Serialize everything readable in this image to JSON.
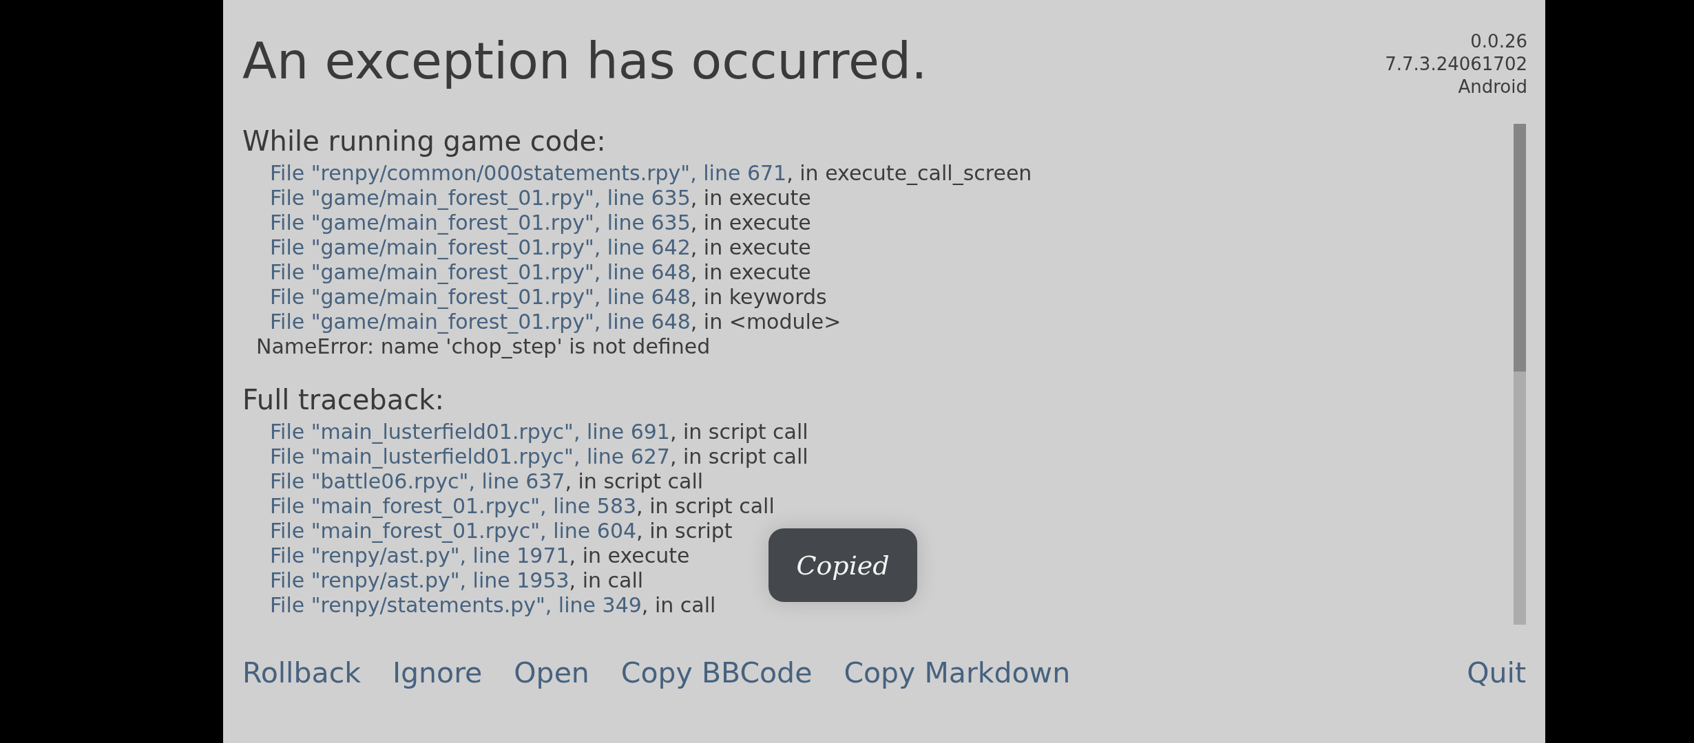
{
  "title": "An exception has occurred.",
  "version_info": [
    "0.0.26",
    "7.7.3.24061702",
    "Android"
  ],
  "sections": [
    {
      "heading": "While running game code:",
      "frames": [
        {
          "location": "File \"renpy/common/000statements.rpy\", line 671",
          "context": ", in execute_call_screen"
        },
        {
          "location": "File \"game/main_forest_01.rpy\", line 635",
          "context": ", in execute"
        },
        {
          "location": "File \"game/main_forest_01.rpy\", line 635",
          "context": ", in execute"
        },
        {
          "location": "File \"game/main_forest_01.rpy\", line 642",
          "context": ", in execute"
        },
        {
          "location": "File \"game/main_forest_01.rpy\", line 648",
          "context": ", in execute"
        },
        {
          "location": "File \"game/main_forest_01.rpy\", line 648",
          "context": ", in keywords"
        },
        {
          "location": "File \"game/main_forest_01.rpy\", line 648",
          "context": ", in <module>"
        }
      ],
      "error": "NameError: name 'chop_step' is not defined"
    },
    {
      "heading": "Full traceback:",
      "frames": [
        {
          "location": "File \"main_lusterfield01.rpyc\", line 691",
          "context": ", in script call"
        },
        {
          "location": "File \"main_lusterfield01.rpyc\", line 627",
          "context": ", in script call"
        },
        {
          "location": "File \"battle06.rpyc\", line 637",
          "context": ", in script call"
        },
        {
          "location": "File \"main_forest_01.rpyc\", line 583",
          "context": ", in script call"
        },
        {
          "location": "File \"main_forest_01.rpyc\", line 604",
          "context": ", in script"
        },
        {
          "location": "File \"renpy/ast.py\", line 1971",
          "context": ", in execute"
        },
        {
          "location": "File \"renpy/ast.py\", line 1953",
          "context": ", in call"
        },
        {
          "location": "File \"renpy/statements.py\", line 349",
          "context": ", in call"
        }
      ]
    }
  ],
  "toast": "Copied",
  "buttons": [
    "Rollback",
    "Ignore",
    "Open",
    "Copy BBCode",
    "Copy Markdown"
  ],
  "quit_button": "Quit"
}
